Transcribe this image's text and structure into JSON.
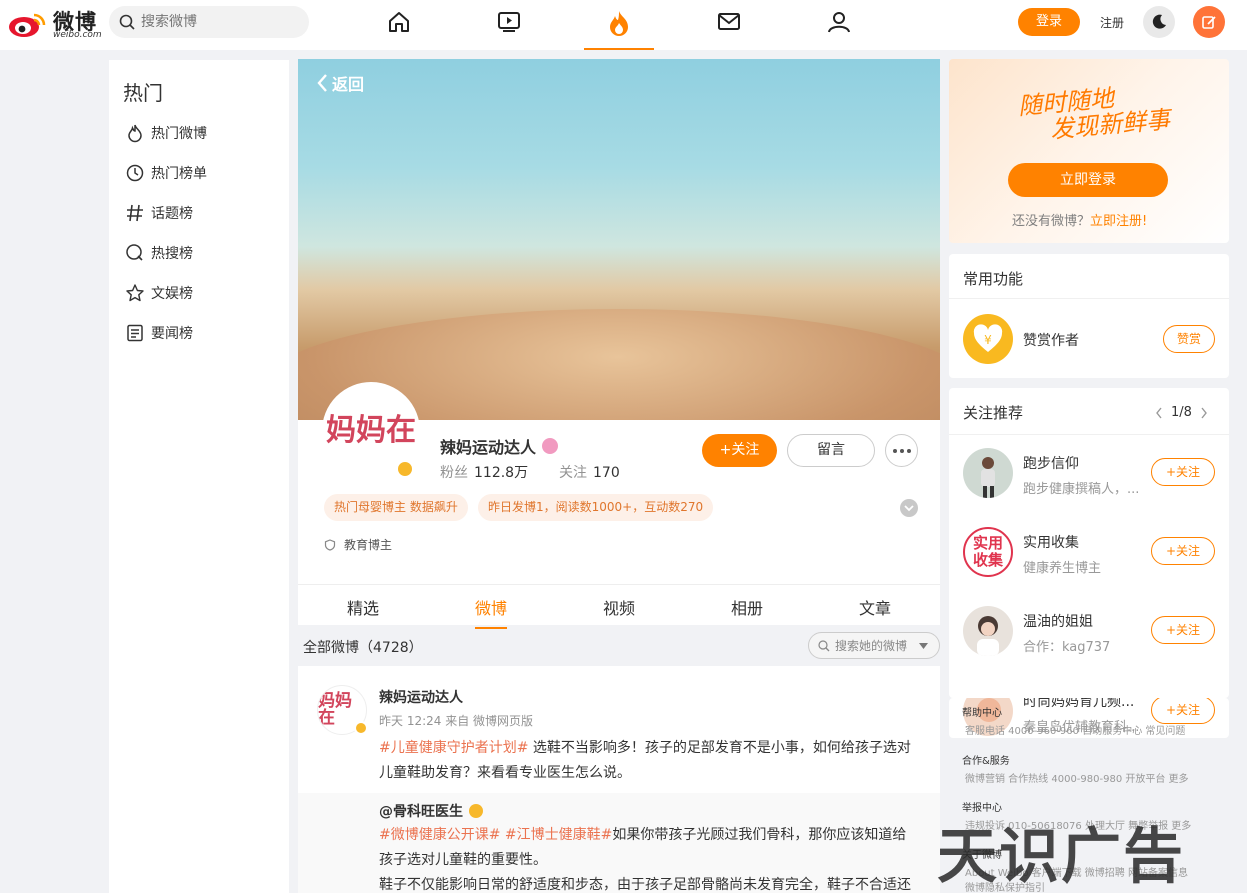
{
  "app": {
    "brand": "微博",
    "brand_sub": "weibo.com"
  },
  "search": {
    "placeholder": "搜索微博"
  },
  "top_nav": {
    "icons": [
      "home-icon",
      "video-icon",
      "hot-icon",
      "mail-icon",
      "profile-icon"
    ],
    "active": "hot-icon",
    "login_label": "登录",
    "register_label": "注册"
  },
  "left_nav": {
    "title": "热门",
    "items": [
      {
        "label": "热门微博",
        "icon": "flame-icon"
      },
      {
        "label": "热门榜单",
        "icon": "clock-icon"
      },
      {
        "label": "话题榜",
        "icon": "hashtag-icon"
      },
      {
        "label": "热搜榜",
        "icon": "search-icon"
      },
      {
        "label": "文娱榜",
        "icon": "star-icon"
      },
      {
        "label": "要闻榜",
        "icon": "news-icon"
      }
    ]
  },
  "profile": {
    "back_label": "返回",
    "avatar_text": "妈妈在",
    "name": "辣妈运动达人",
    "fans_label": "粉丝",
    "fans_value": "112.8万",
    "follow_label": "关注",
    "follow_value": "170",
    "follow_button": "+关注",
    "message_button": "留言",
    "chips": [
      "热门母婴博主 数据飙升",
      "昨日发博1，阅读数1000+，互动数270"
    ],
    "category": "教育博主"
  },
  "tabs": [
    "精选",
    "微博",
    "视频",
    "相册",
    "文章"
  ],
  "active_tab": "微博",
  "feed": {
    "all_label": "全部微博（4728）",
    "search_placeholder": "搜索她的微博"
  },
  "post": {
    "avatar_text": "妈妈在",
    "author": "辣妈运动达人",
    "meta": "昨天 12:24 来自 微博网页版",
    "hashtag": "#儿童健康守护者计划#",
    "text": " 选鞋不当影响多！孩子的足部发育不是小事，如何给孩子选对儿童鞋助发育？来看看专业医生怎么说。",
    "repost_author": "@骨科旺医生",
    "repost_hashtag1": "#微博健康公开课#",
    "repost_hashtag2": " #江博士健康鞋#",
    "repost_text": "如果你带孩子光顾过我们骨科，那你应该知道给孩子选对儿童鞋的重要性。",
    "repost_text2": "鞋子不仅能影响日常的舒适度和步态，由于孩子足部骨骼尚未发育完全，鞋子不合适还"
  },
  "right_login": {
    "slogan_line1": "随时随地",
    "slogan_line2": "发现新鲜事",
    "cta": "立即登录",
    "hint_prefix": "还没有微博？",
    "hint_link": "立即注册!"
  },
  "common_functions": {
    "title": "常用功能",
    "feature_name": "赞赏作者",
    "feature_button": "赞赏"
  },
  "recommend": {
    "title": "关注推荐",
    "page": "1/8",
    "follow_label": "+关注",
    "items": [
      {
        "name": "跑步信仰",
        "desc": "跑步健康撰稿人，..."
      },
      {
        "name": "实用收集",
        "desc": "健康养生博主",
        "avatar_text": "实用收集"
      },
      {
        "name": "温油的姐姐",
        "desc": "合作：kag737"
      },
      {
        "name": "时尚妈妈育儿频...",
        "desc": "秦皇岛优辅教育科..."
      }
    ]
  },
  "footer": {
    "help_title": "帮助中心",
    "help_line": "客服电话 4000-960-960    自助服务中心    常见问题",
    "coop_title": "合作&服务",
    "coop_line": "微博营销    合作热线 4000-980-980    开放平台    更多",
    "report_title": "举报中心",
    "report_line": "违规投诉 010-50618076    处理大厅    舞弊举报    更多",
    "about_title": "关于微博",
    "about_line": "About Weibo    客户端下载    微博招聘    网站备案信息",
    "about_line2": "微博隐私保护指引"
  },
  "watermark": "天识广告",
  "colors": {
    "accent": "#ff8200",
    "hashtag": "#eb7350",
    "gold": "#f7b82b"
  }
}
